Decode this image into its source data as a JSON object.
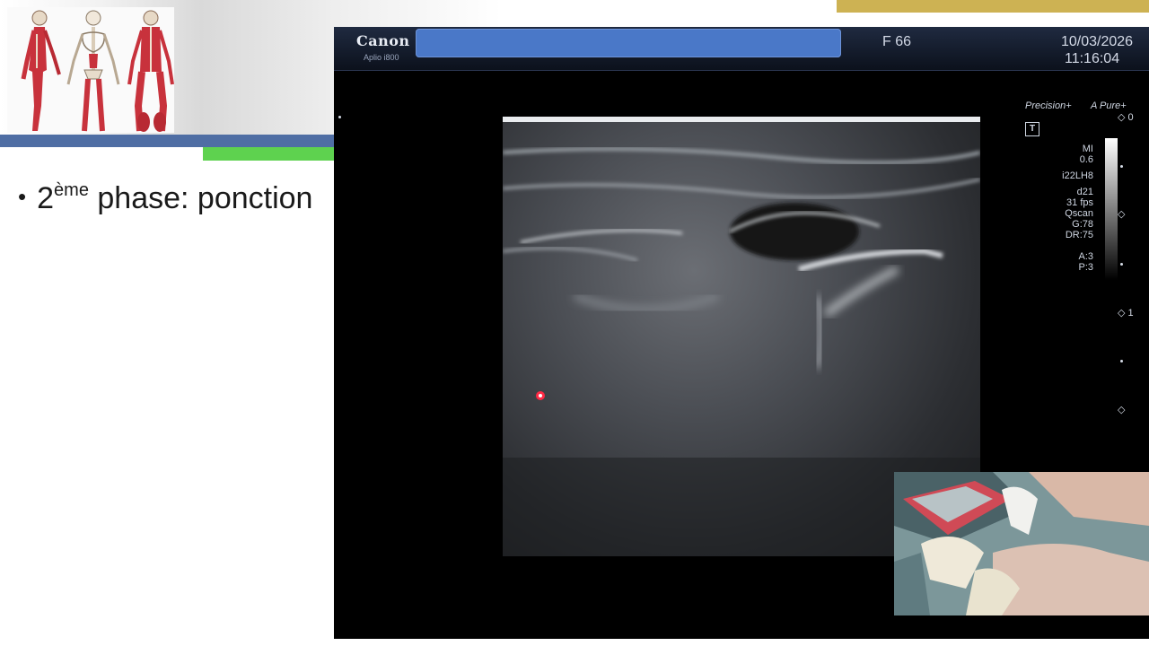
{
  "slide": {
    "bullet_number": "2",
    "bullet_superscript": "ème",
    "bullet_text": " phase: ponction",
    "colors": {
      "blue_bar": "#4f6ea4",
      "green_bar": "#5ed24f",
      "gold_bar": "#cdb253"
    }
  },
  "ultrasound": {
    "brand": "Canon",
    "model": "Aplio i800",
    "frame": "F 66",
    "date": "10/03/2026",
    "time": "11:16:04",
    "precision_label": "Precision+",
    "apure_label": "A Pure+",
    "t_marker": "T",
    "params": {
      "mi_label": "MI",
      "mi_value": "0.6",
      "probe": "i22LH8",
      "depth": "d21",
      "fps": "31 fps",
      "qscan": "Qscan",
      "gain": "G:78",
      "dr": "DR:75",
      "a": "A:3",
      "p": "P:3"
    },
    "depth_labels": [
      "0",
      "1"
    ],
    "overlay_cover_color": "#4a78c8"
  }
}
